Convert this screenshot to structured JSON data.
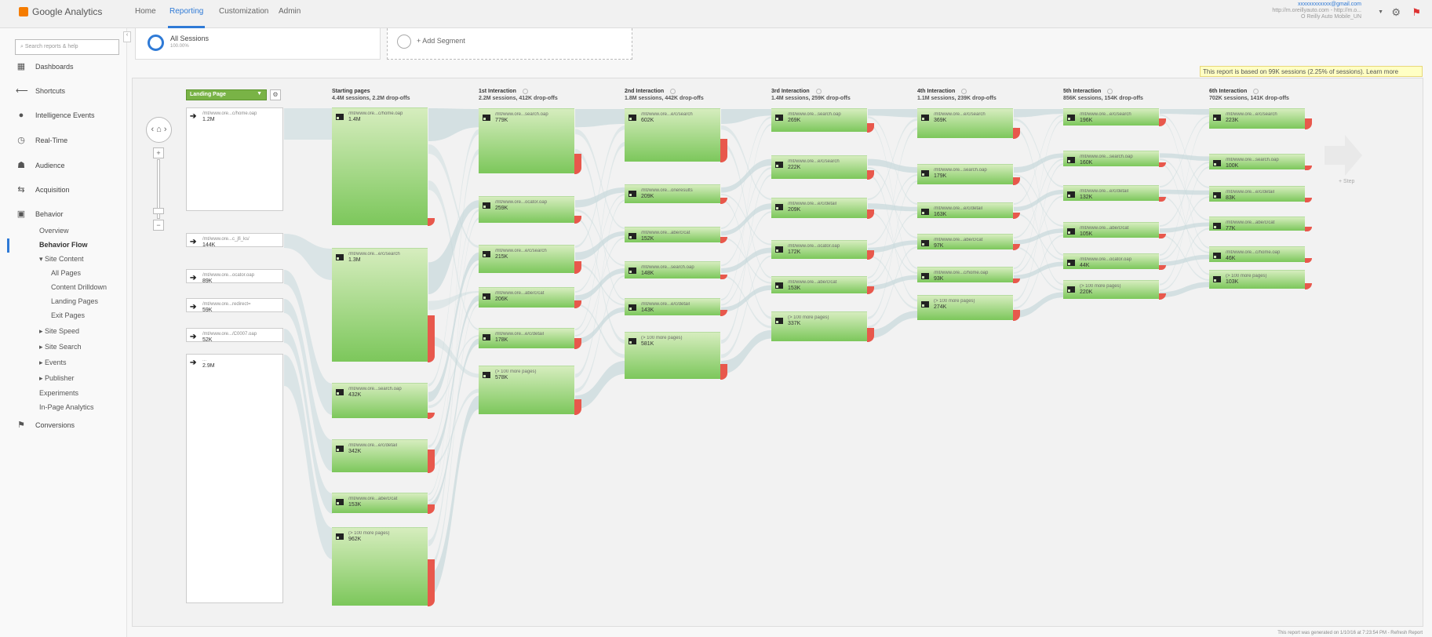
{
  "app": {
    "title": "Google Analytics"
  },
  "topnav": {
    "tabs": [
      {
        "label": "Home",
        "active": false
      },
      {
        "label": "Reporting",
        "active": true
      },
      {
        "label": "Customization",
        "active": false
      },
      {
        "label": "Admin",
        "active": false
      }
    ]
  },
  "account": {
    "email": "xxxxxxxxxxxx@gmail.com",
    "property": "http://m.oreillyauto.com - http://m.o...",
    "view": "O Reilly Auto Mobile_UN"
  },
  "sidebar": {
    "search_placeholder": "Search reports & help",
    "items": [
      {
        "label": "Dashboards",
        "icon": "dashboard-icon"
      },
      {
        "label": "Shortcuts",
        "icon": "shortcut-arrow-icon"
      },
      {
        "label": "Intelligence Events",
        "icon": "lightbulb-icon"
      },
      {
        "label": "Real-Time",
        "icon": "clock-icon"
      },
      {
        "label": "Audience",
        "icon": "people-icon"
      },
      {
        "label": "Acquisition",
        "icon": "acquisition-icon"
      },
      {
        "label": "Behavior",
        "icon": "behavior-icon"
      },
      {
        "label": "Conversions",
        "icon": "flag-icon"
      }
    ],
    "behavior_sub": [
      {
        "label": "Overview"
      },
      {
        "label": "Behavior Flow"
      },
      {
        "label": "▾ Site Content"
      },
      {
        "label": "All Pages"
      },
      {
        "label": "Content Drilldown"
      },
      {
        "label": "Landing Pages"
      },
      {
        "label": "Exit Pages"
      },
      {
        "label": "▸ Site Speed"
      },
      {
        "label": "▸ Site Search"
      },
      {
        "label": "▸ Events"
      },
      {
        "label": "▸ Publisher"
      },
      {
        "label": "Experiments"
      },
      {
        "label": "In-Page Analytics"
      }
    ]
  },
  "segments": {
    "active": {
      "name": "All Sessions",
      "pct": "100.00%"
    },
    "add_label": "+ Add Segment"
  },
  "sampling_notice": "This report is based on 99K sessions (2.25% of sessions). Learn more",
  "flow": {
    "dimension_label": "Landing Page",
    "step_label": "+ Step",
    "columns": [
      {
        "title": "Starting pages",
        "sub": "4.4M sessions, 2.2M drop-offs"
      },
      {
        "title": "1st Interaction",
        "sub": "2.2M sessions, 412K drop-offs"
      },
      {
        "title": "2nd Interaction",
        "sub": "1.8M sessions, 442K drop-offs"
      },
      {
        "title": "3rd Interaction",
        "sub": "1.4M sessions, 259K drop-offs"
      },
      {
        "title": "4th Interaction",
        "sub": "1.1M sessions, 239K drop-offs"
      },
      {
        "title": "5th Interaction",
        "sub": "856K sessions, 154K drop-offs"
      },
      {
        "title": "6th Interaction",
        "sub": "702K sessions, 141K drop-offs"
      }
    ],
    "landing": [
      {
        "label": "/mt/www.ore...c/home.oap",
        "value": "1.2M"
      },
      {
        "label": "/mt/www.ore...c_jfi_ks/",
        "value": "144K"
      },
      {
        "label": "/mt/www.ore...ocator.oap",
        "value": "89K"
      },
      {
        "label": "/mt/www.ore...redirect=",
        "value": "59K"
      },
      {
        "label": "/mt/www.ore.../C0007.oap",
        "value": "52K"
      },
      {
        "label": "...",
        "value": "2.9M"
      }
    ],
    "nodes": [
      [
        {
          "label": "/mt/www.ore...c/home.oap",
          "value": "1.4M"
        },
        {
          "label": "/mt/www.ore...e/c/search",
          "value": "1.3M"
        },
        {
          "label": "/mt/www.ore...search.oap",
          "value": "432K"
        },
        {
          "label": "/mt/www.ore...e/c/detail",
          "value": "342K"
        },
        {
          "label": "/mt/www.ore...abe/c/cat",
          "value": "153K"
        },
        {
          "label": "(> 100 more pages)",
          "value": "962K"
        }
      ],
      [
        {
          "label": "/mt/www.ore...search.oap",
          "value": "779K"
        },
        {
          "label": "/mt/www.ore...ocator.oap",
          "value": "259K"
        },
        {
          "label": "/mt/www.ore...e/c/search",
          "value": "215K"
        },
        {
          "label": "/mt/www.ore...abe/c/cat",
          "value": "206K"
        },
        {
          "label": "/mt/www.ore...e/c/detail",
          "value": "178K"
        },
        {
          "label": "(> 100 more pages)",
          "value": "578K"
        }
      ],
      [
        {
          "label": "/mt/www.ore...e/c/search",
          "value": "602K"
        },
        {
          "label": "/mt/www.ore...oneresults",
          "value": "209K"
        },
        {
          "label": "/mt/www.ore...abe/c/cat",
          "value": "152K"
        },
        {
          "label": "/mt/www.ore...search.oap",
          "value": "148K"
        },
        {
          "label": "/mt/www.ore...e/c/detail",
          "value": "143K"
        },
        {
          "label": "(> 100 more pages)",
          "value": "581K"
        }
      ],
      [
        {
          "label": "/mt/www.ore...search.oap",
          "value": "269K"
        },
        {
          "label": "/mt/www.ore...e/c/search",
          "value": "222K"
        },
        {
          "label": "/mt/www.ore...e/c/detail",
          "value": "209K"
        },
        {
          "label": "/mt/www.ore...ocator.oap",
          "value": "172K"
        },
        {
          "label": "/mt/www.ore...abe/c/cat",
          "value": "153K"
        },
        {
          "label": "(> 100 more pages)",
          "value": "337K"
        }
      ],
      [
        {
          "label": "/mt/www.ore...e/c/search",
          "value": "369K"
        },
        {
          "label": "/mt/www.ore...search.oap",
          "value": "179K"
        },
        {
          "label": "/mt/www.ore...e/c/detail",
          "value": "163K"
        },
        {
          "label": "/mt/www.ore...abe/c/cat",
          "value": "97K"
        },
        {
          "label": "/mt/www.ore...c/home.oap",
          "value": "93K"
        },
        {
          "label": "(> 100 more pages)",
          "value": "274K"
        }
      ],
      [
        {
          "label": "/mt/www.ore...e/c/search",
          "value": "196K"
        },
        {
          "label": "/mt/www.ore...search.oap",
          "value": "160K"
        },
        {
          "label": "/mt/www.ore...e/c/detail",
          "value": "132K"
        },
        {
          "label": "/mt/www.ore...abe/c/cat",
          "value": "105K"
        },
        {
          "label": "/mt/www.ore...ocator.oap",
          "value": "44K"
        },
        {
          "label": "(> 100 more pages)",
          "value": "220K"
        }
      ],
      [
        {
          "label": "/mt/www.ore...e/c/search",
          "value": "223K"
        },
        {
          "label": "/mt/www.ore...search.oap",
          "value": "100K"
        },
        {
          "label": "/mt/www.ore...e/c/detail",
          "value": "83K"
        },
        {
          "label": "/mt/www.ore...abe/c/cat",
          "value": "77K"
        },
        {
          "label": "/mt/www.ore...c/home.oap",
          "value": "46K"
        },
        {
          "label": "(> 100 more pages)",
          "value": "103K"
        }
      ]
    ]
  },
  "footer": "This report was generated on 1/10/16 at 7:23:54 PM - Refresh Report",
  "colors": {
    "accent": "#2f7ad6",
    "node_green": "#7cc75b",
    "dropoff_red": "#e8584c",
    "brand_orange": "#f57c00"
  }
}
